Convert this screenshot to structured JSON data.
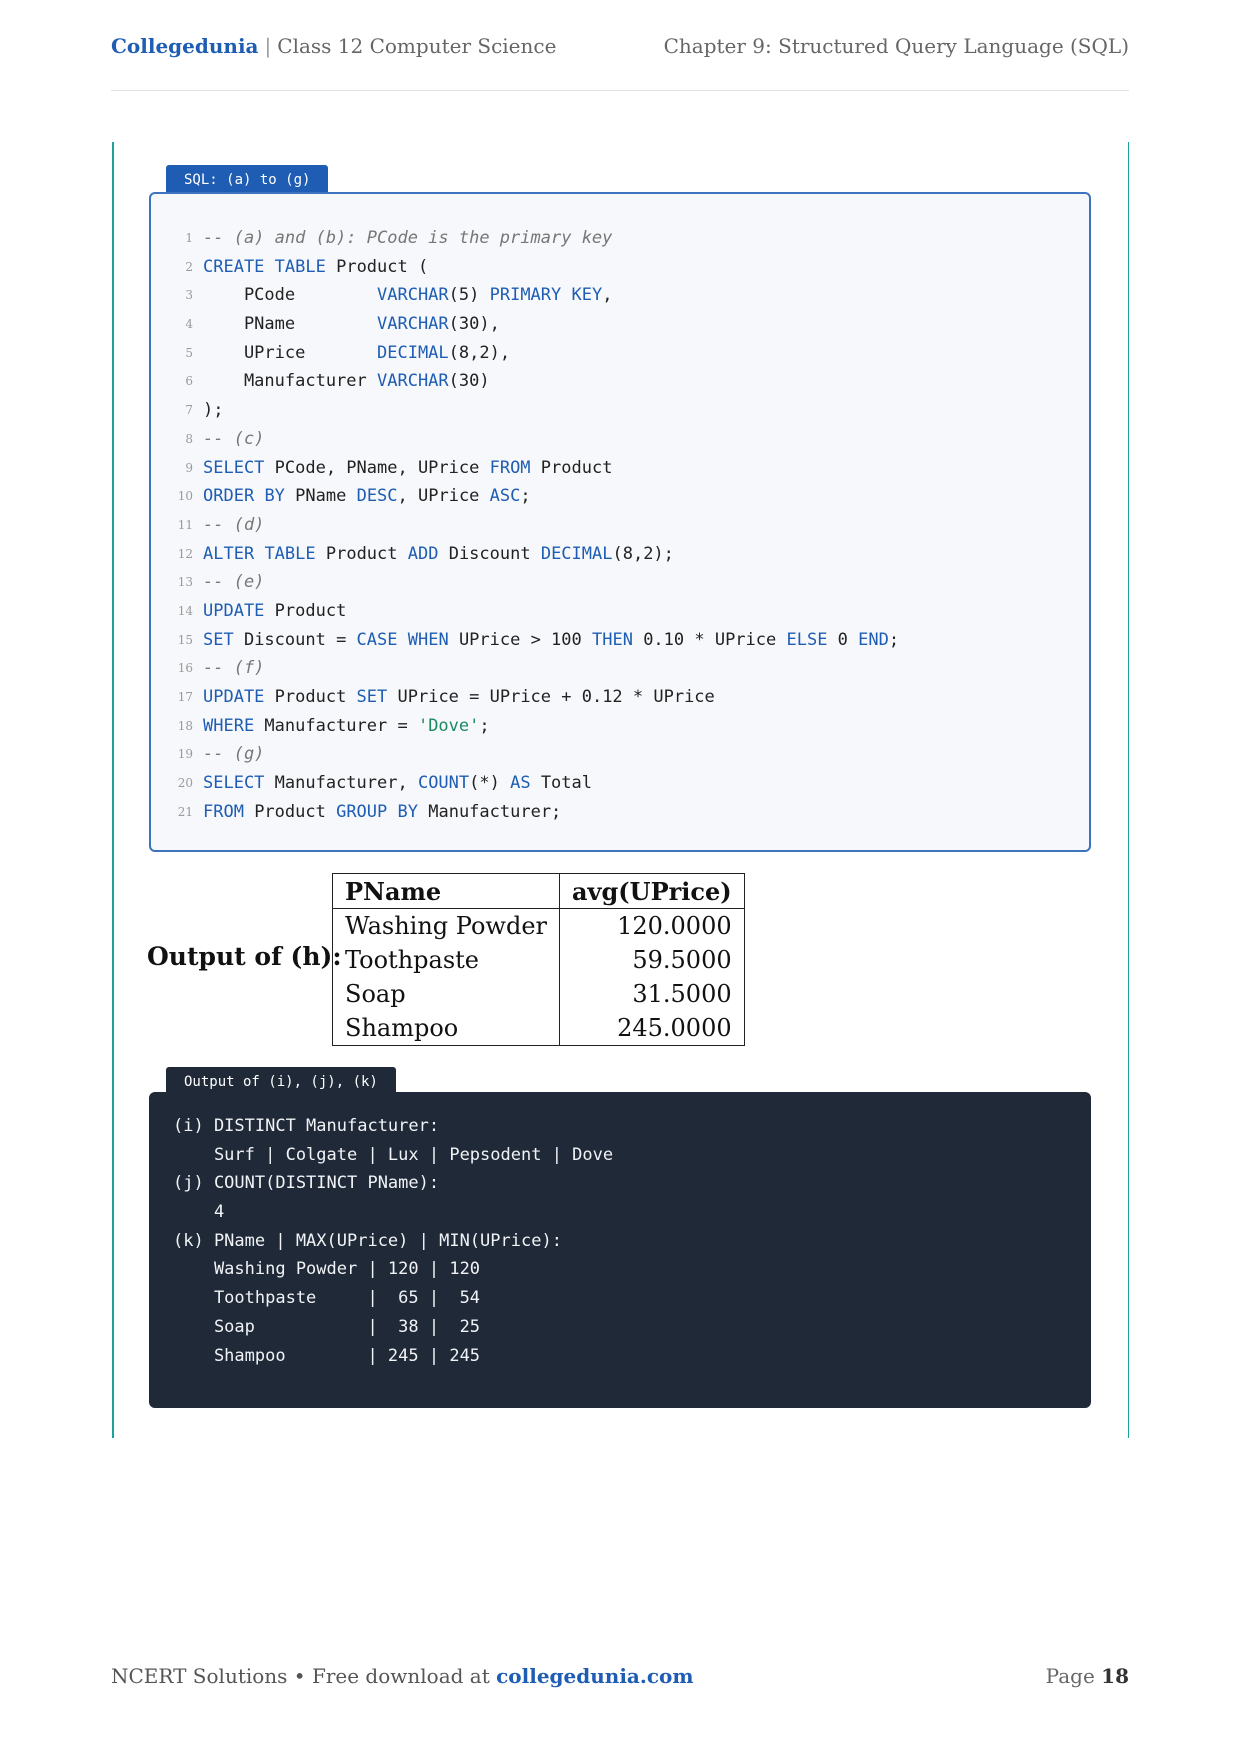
{
  "header": {
    "brand": "Collegedunia",
    "separator": "|",
    "course": "Class 12 Computer Science",
    "chapter": "Chapter 9: Structured Query Language (SQL)"
  },
  "sql_block": {
    "tab_label": "SQL: (a) to (g)",
    "lines": [
      {
        "n": "1",
        "t": [
          [
            "cm",
            "-- (a) and (b): PCode is the primary key"
          ]
        ]
      },
      {
        "n": "2",
        "t": [
          [
            "kw",
            "CREATE"
          ],
          [
            "",
            " "
          ],
          [
            "kw",
            "TABLE"
          ],
          [
            "",
            " Product ("
          ]
        ]
      },
      {
        "n": "3",
        "t": [
          [
            "",
            "    PCode        "
          ],
          [
            "kw",
            "VARCHAR"
          ],
          [
            "",
            "(5) "
          ],
          [
            "kw",
            "PRIMARY"
          ],
          [
            "",
            " "
          ],
          [
            "kw",
            "KEY"
          ],
          [
            "",
            ","
          ]
        ]
      },
      {
        "n": "4",
        "t": [
          [
            "",
            "    PName        "
          ],
          [
            "kw",
            "VARCHAR"
          ],
          [
            "",
            "(30),"
          ]
        ]
      },
      {
        "n": "5",
        "t": [
          [
            "",
            "    UPrice       "
          ],
          [
            "kw",
            "DECIMAL"
          ],
          [
            "",
            "(8,2),"
          ]
        ]
      },
      {
        "n": "6",
        "t": [
          [
            "",
            "    Manufacturer "
          ],
          [
            "kw",
            "VARCHAR"
          ],
          [
            "",
            "(30)"
          ]
        ]
      },
      {
        "n": "7",
        "t": [
          [
            "",
            ");"
          ]
        ]
      },
      {
        "n": "8",
        "t": [
          [
            "cm",
            "-- (c)"
          ]
        ]
      },
      {
        "n": "9",
        "t": [
          [
            "kw",
            "SELECT"
          ],
          [
            "",
            " PCode, PName, UPrice "
          ],
          [
            "kw",
            "FROM"
          ],
          [
            "",
            " Product"
          ]
        ]
      },
      {
        "n": "10",
        "t": [
          [
            "kw",
            "ORDER"
          ],
          [
            "",
            " "
          ],
          [
            "kw",
            "BY"
          ],
          [
            "",
            " PName "
          ],
          [
            "kw",
            "DESC"
          ],
          [
            "",
            ", UPrice "
          ],
          [
            "kw",
            "ASC"
          ],
          [
            "",
            ";"
          ]
        ]
      },
      {
        "n": "11",
        "t": [
          [
            "cm",
            "-- (d)"
          ]
        ]
      },
      {
        "n": "12",
        "t": [
          [
            "kw",
            "ALTER"
          ],
          [
            "",
            " "
          ],
          [
            "kw",
            "TABLE"
          ],
          [
            "",
            " Product "
          ],
          [
            "kw",
            "ADD"
          ],
          [
            "",
            " Discount "
          ],
          [
            "kw",
            "DECIMAL"
          ],
          [
            "",
            "(8,2);"
          ]
        ]
      },
      {
        "n": "13",
        "t": [
          [
            "cm",
            "-- (e)"
          ]
        ]
      },
      {
        "n": "14",
        "t": [
          [
            "kw",
            "UPDATE"
          ],
          [
            "",
            " Product"
          ]
        ]
      },
      {
        "n": "15",
        "t": [
          [
            "kw",
            "SET"
          ],
          [
            "",
            " Discount = "
          ],
          [
            "kw",
            "CASE"
          ],
          [
            "",
            " "
          ],
          [
            "kw",
            "WHEN"
          ],
          [
            "",
            " UPrice > 100 "
          ],
          [
            "kw",
            "THEN"
          ],
          [
            "",
            " 0.10 * UPrice "
          ],
          [
            "kw",
            "ELSE"
          ],
          [
            "",
            " 0 "
          ],
          [
            "kw",
            "END"
          ],
          [
            "",
            ";"
          ]
        ]
      },
      {
        "n": "16",
        "t": [
          [
            "cm",
            "-- (f)"
          ]
        ]
      },
      {
        "n": "17",
        "t": [
          [
            "kw",
            "UPDATE"
          ],
          [
            "",
            " Product "
          ],
          [
            "kw",
            "SET"
          ],
          [
            "",
            " UPrice = UPrice + 0.12 * UPrice"
          ]
        ]
      },
      {
        "n": "18",
        "t": [
          [
            "kw",
            "WHERE"
          ],
          [
            "",
            " Manufacturer = "
          ],
          [
            "st",
            "'Dove'"
          ],
          [
            "",
            ";"
          ]
        ]
      },
      {
        "n": "19",
        "t": [
          [
            "cm",
            "-- (g)"
          ]
        ]
      },
      {
        "n": "20",
        "t": [
          [
            "kw",
            "SELECT"
          ],
          [
            "",
            " Manufacturer, "
          ],
          [
            "kw",
            "COUNT"
          ],
          [
            "",
            "(*) "
          ],
          [
            "kw",
            "AS"
          ],
          [
            "",
            " Total"
          ]
        ]
      },
      {
        "n": "21",
        "t": [
          [
            "kw",
            "FROM"
          ],
          [
            "",
            " Product "
          ],
          [
            "kw",
            "GROUP"
          ],
          [
            "",
            " "
          ],
          [
            "kw",
            "BY"
          ],
          [
            "",
            " Manufacturer;"
          ]
        ]
      }
    ]
  },
  "output_h": {
    "label": "Output of (h):",
    "columns": [
      "PName",
      "avg(UPrice)"
    ],
    "rows": [
      [
        "Washing Powder",
        "120.0000"
      ],
      [
        "Toothpaste",
        "59.5000"
      ],
      [
        "Soap",
        "31.5000"
      ],
      [
        "Shampoo",
        "245.0000"
      ]
    ]
  },
  "output_ijk": {
    "tab_label": "Output of (i), (j), (k)",
    "lines": [
      "(i) DISTINCT Manufacturer:",
      "    Surf | Colgate | Lux | Pepsodent | Dove",
      "(j) COUNT(DISTINCT PName):",
      "    4",
      "(k) PName | MAX(UPrice) | MIN(UPrice):",
      "    Washing Powder | 120 | 120",
      "    Toothpaste     |  65 |  54",
      "    Soap           |  38 |  25",
      "    Shampoo        | 245 | 245"
    ]
  },
  "footer": {
    "left_text": "NCERT Solutions • Free download at ",
    "link_text": "collegedunia.com",
    "page_label": "Page",
    "page_number": "18"
  }
}
